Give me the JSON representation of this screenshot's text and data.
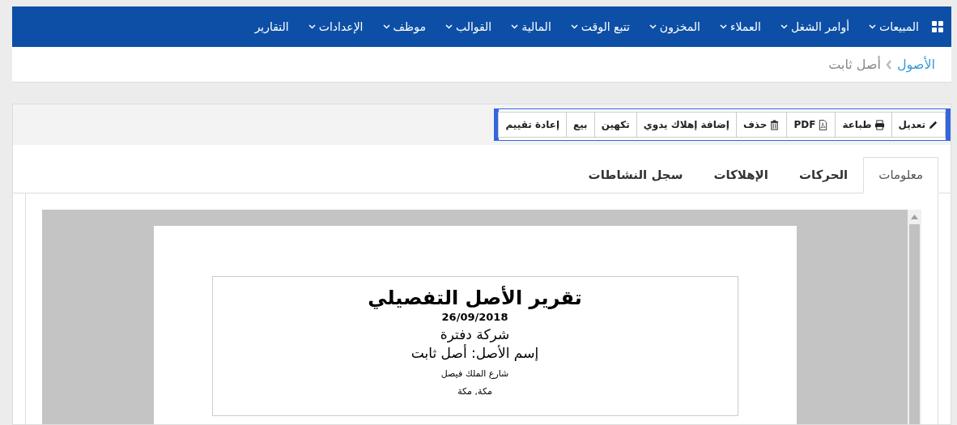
{
  "navbar": {
    "items": [
      {
        "label": "المبيعات",
        "dropdown": true
      },
      {
        "label": "أوامر الشغل",
        "dropdown": true
      },
      {
        "label": "العملاء",
        "dropdown": true
      },
      {
        "label": "المخزون",
        "dropdown": true
      },
      {
        "label": "تتبع الوقت",
        "dropdown": true
      },
      {
        "label": "المالية",
        "dropdown": true
      },
      {
        "label": "القوالب",
        "dropdown": true
      },
      {
        "label": "موظف",
        "dropdown": true
      },
      {
        "label": "الإعدادات",
        "dropdown": true
      },
      {
        "label": "التقارير",
        "dropdown": false
      }
    ]
  },
  "breadcrumb": [
    {
      "label": "الأصول",
      "link": true
    },
    {
      "label": "أصل ثابت",
      "link": false
    }
  ],
  "toolbar": [
    {
      "label": "تعديل",
      "kind": "edit"
    },
    {
      "label": "طباعة",
      "kind": "print"
    },
    {
      "label": "PDF",
      "kind": "pdf"
    },
    {
      "label": "حذف",
      "kind": "delete"
    },
    {
      "label": "إضافة إهلاك يدوي",
      "kind": "plain"
    },
    {
      "label": "تكهين",
      "kind": "plain"
    },
    {
      "label": "بيع",
      "kind": "plain"
    },
    {
      "label": "إعادة تقييم",
      "kind": "plain"
    }
  ],
  "tabs": [
    {
      "label": "معلومات",
      "selected": true
    },
    {
      "label": "الحركات",
      "selected": false
    },
    {
      "label": "الإهلاكات",
      "selected": false
    },
    {
      "label": "سجل النشاطات",
      "selected": false
    }
  ],
  "report": {
    "title": "تقرير الأصل التفصيلي",
    "date": "26/09/2018",
    "company": "شركة دفترة",
    "asset_name": "إسم الأصل: أصل ثابت",
    "address_line": "شارع الملك فيصل",
    "city": "مكة, مكة"
  }
}
